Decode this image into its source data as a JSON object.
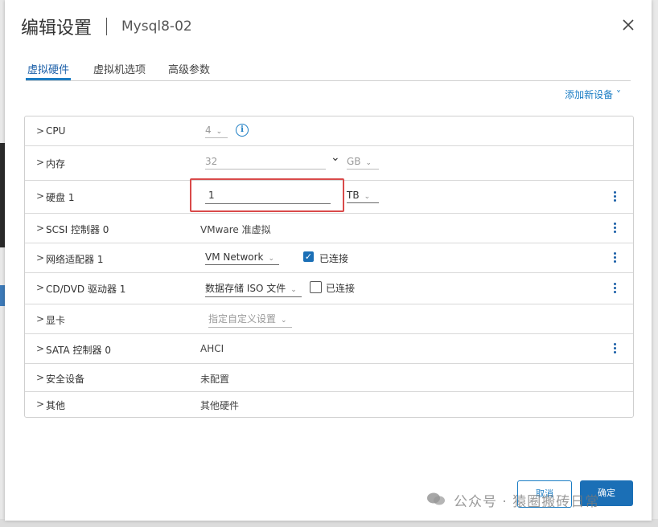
{
  "dialog": {
    "title": "编辑设置",
    "vm_name": "Mysql8-02"
  },
  "tabs": [
    {
      "label": "虚拟硬件",
      "active": true
    },
    {
      "label": "虚拟机选项",
      "active": false
    },
    {
      "label": "高级参数",
      "active": false
    }
  ],
  "add_device_label": "添加新设备 ˅",
  "rows": {
    "cpu": {
      "label": "CPU",
      "value": "4"
    },
    "memory": {
      "label": "内存",
      "value": "32",
      "unit": "GB"
    },
    "disk": {
      "label": "硬盘 1",
      "value": "1",
      "unit": "TB"
    },
    "scsi": {
      "label": "SCSI 控制器 0",
      "value": "VMware 准虚拟"
    },
    "network": {
      "label": "网络适配器 1",
      "value": "VM Network",
      "connected_label": "已连接",
      "connected": true
    },
    "cdrom": {
      "label": "CD/DVD 驱动器 1",
      "value": "数据存储 ISO 文件",
      "connected_label": "已连接",
      "connected": false
    },
    "video": {
      "label": "显卡",
      "value": "指定自定义设置"
    },
    "sata": {
      "label": "SATA 控制器 0",
      "value": "AHCI"
    },
    "security": {
      "label": "安全设备",
      "value": "未配置"
    },
    "other": {
      "label": "其他",
      "value": "其他硬件"
    }
  },
  "buttons": {
    "cancel": "取消",
    "ok": "确定"
  },
  "watermark": "公众号 · 猿圈搬砖日常",
  "colors": {
    "accent": "#1b7dc4",
    "primary_button": "#1b6fb6",
    "highlight_box": "#d94a4a"
  }
}
